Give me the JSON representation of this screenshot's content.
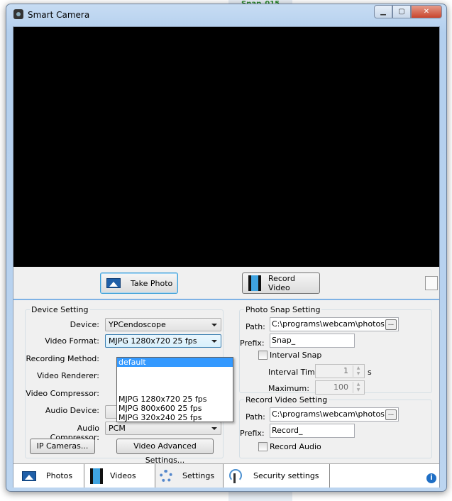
{
  "window": {
    "title": "Smart Camera",
    "background_text": "Snap_015"
  },
  "toolbar": {
    "take_photo": "Take Photo",
    "record_video": "Record Video"
  },
  "device_setting": {
    "title": "Device Setting",
    "device_label": "Device:",
    "device_value": "YPCendoscope",
    "video_format_label": "Video Format:",
    "video_format_value": "MJPG 1280x720 25 fps",
    "recording_method_label": "Recording Method:",
    "video_renderer_label": "Video Renderer:",
    "video_compressor_label": "Video Compressor:",
    "audio_device_label": "Audio Device:",
    "audio_compressor_label": "Audio Compressor:",
    "audio_compressor_value": "PCM",
    "ip_cameras": "IP Cameras...",
    "video_advanced": "Video Advanced Settings...",
    "dropdown_options": [
      "default",
      "MJPG 1280x720 25 fps",
      "MJPG 800x600 25 fps",
      "MJPG 320x240 25 fps"
    ]
  },
  "photo_snap": {
    "title": "Photo Snap Setting",
    "path_label": "Path:",
    "path_value": "C:\\programs\\webcam\\photos",
    "prefix_label": "Prefix:",
    "prefix_value": "Snap_",
    "interval_snap": "Interval Snap",
    "interval_time_label": "Interval Time:",
    "interval_time_value": "1",
    "interval_unit": "s",
    "maximum_label": "Maximum:",
    "maximum_value": "100",
    "browse": "..."
  },
  "record_video": {
    "title": "Record Video Setting",
    "path_label": "Path:",
    "path_value": "C:\\programs\\webcam\\photos",
    "prefix_label": "Prefix:",
    "prefix_value": "Record_",
    "record_audio": "Record Audio",
    "browse": "..."
  },
  "tabs": [
    {
      "label": "Photos"
    },
    {
      "label": "Videos"
    },
    {
      "label": "Settings"
    },
    {
      "label": "Security settings"
    }
  ],
  "active_tab": "Videos"
}
